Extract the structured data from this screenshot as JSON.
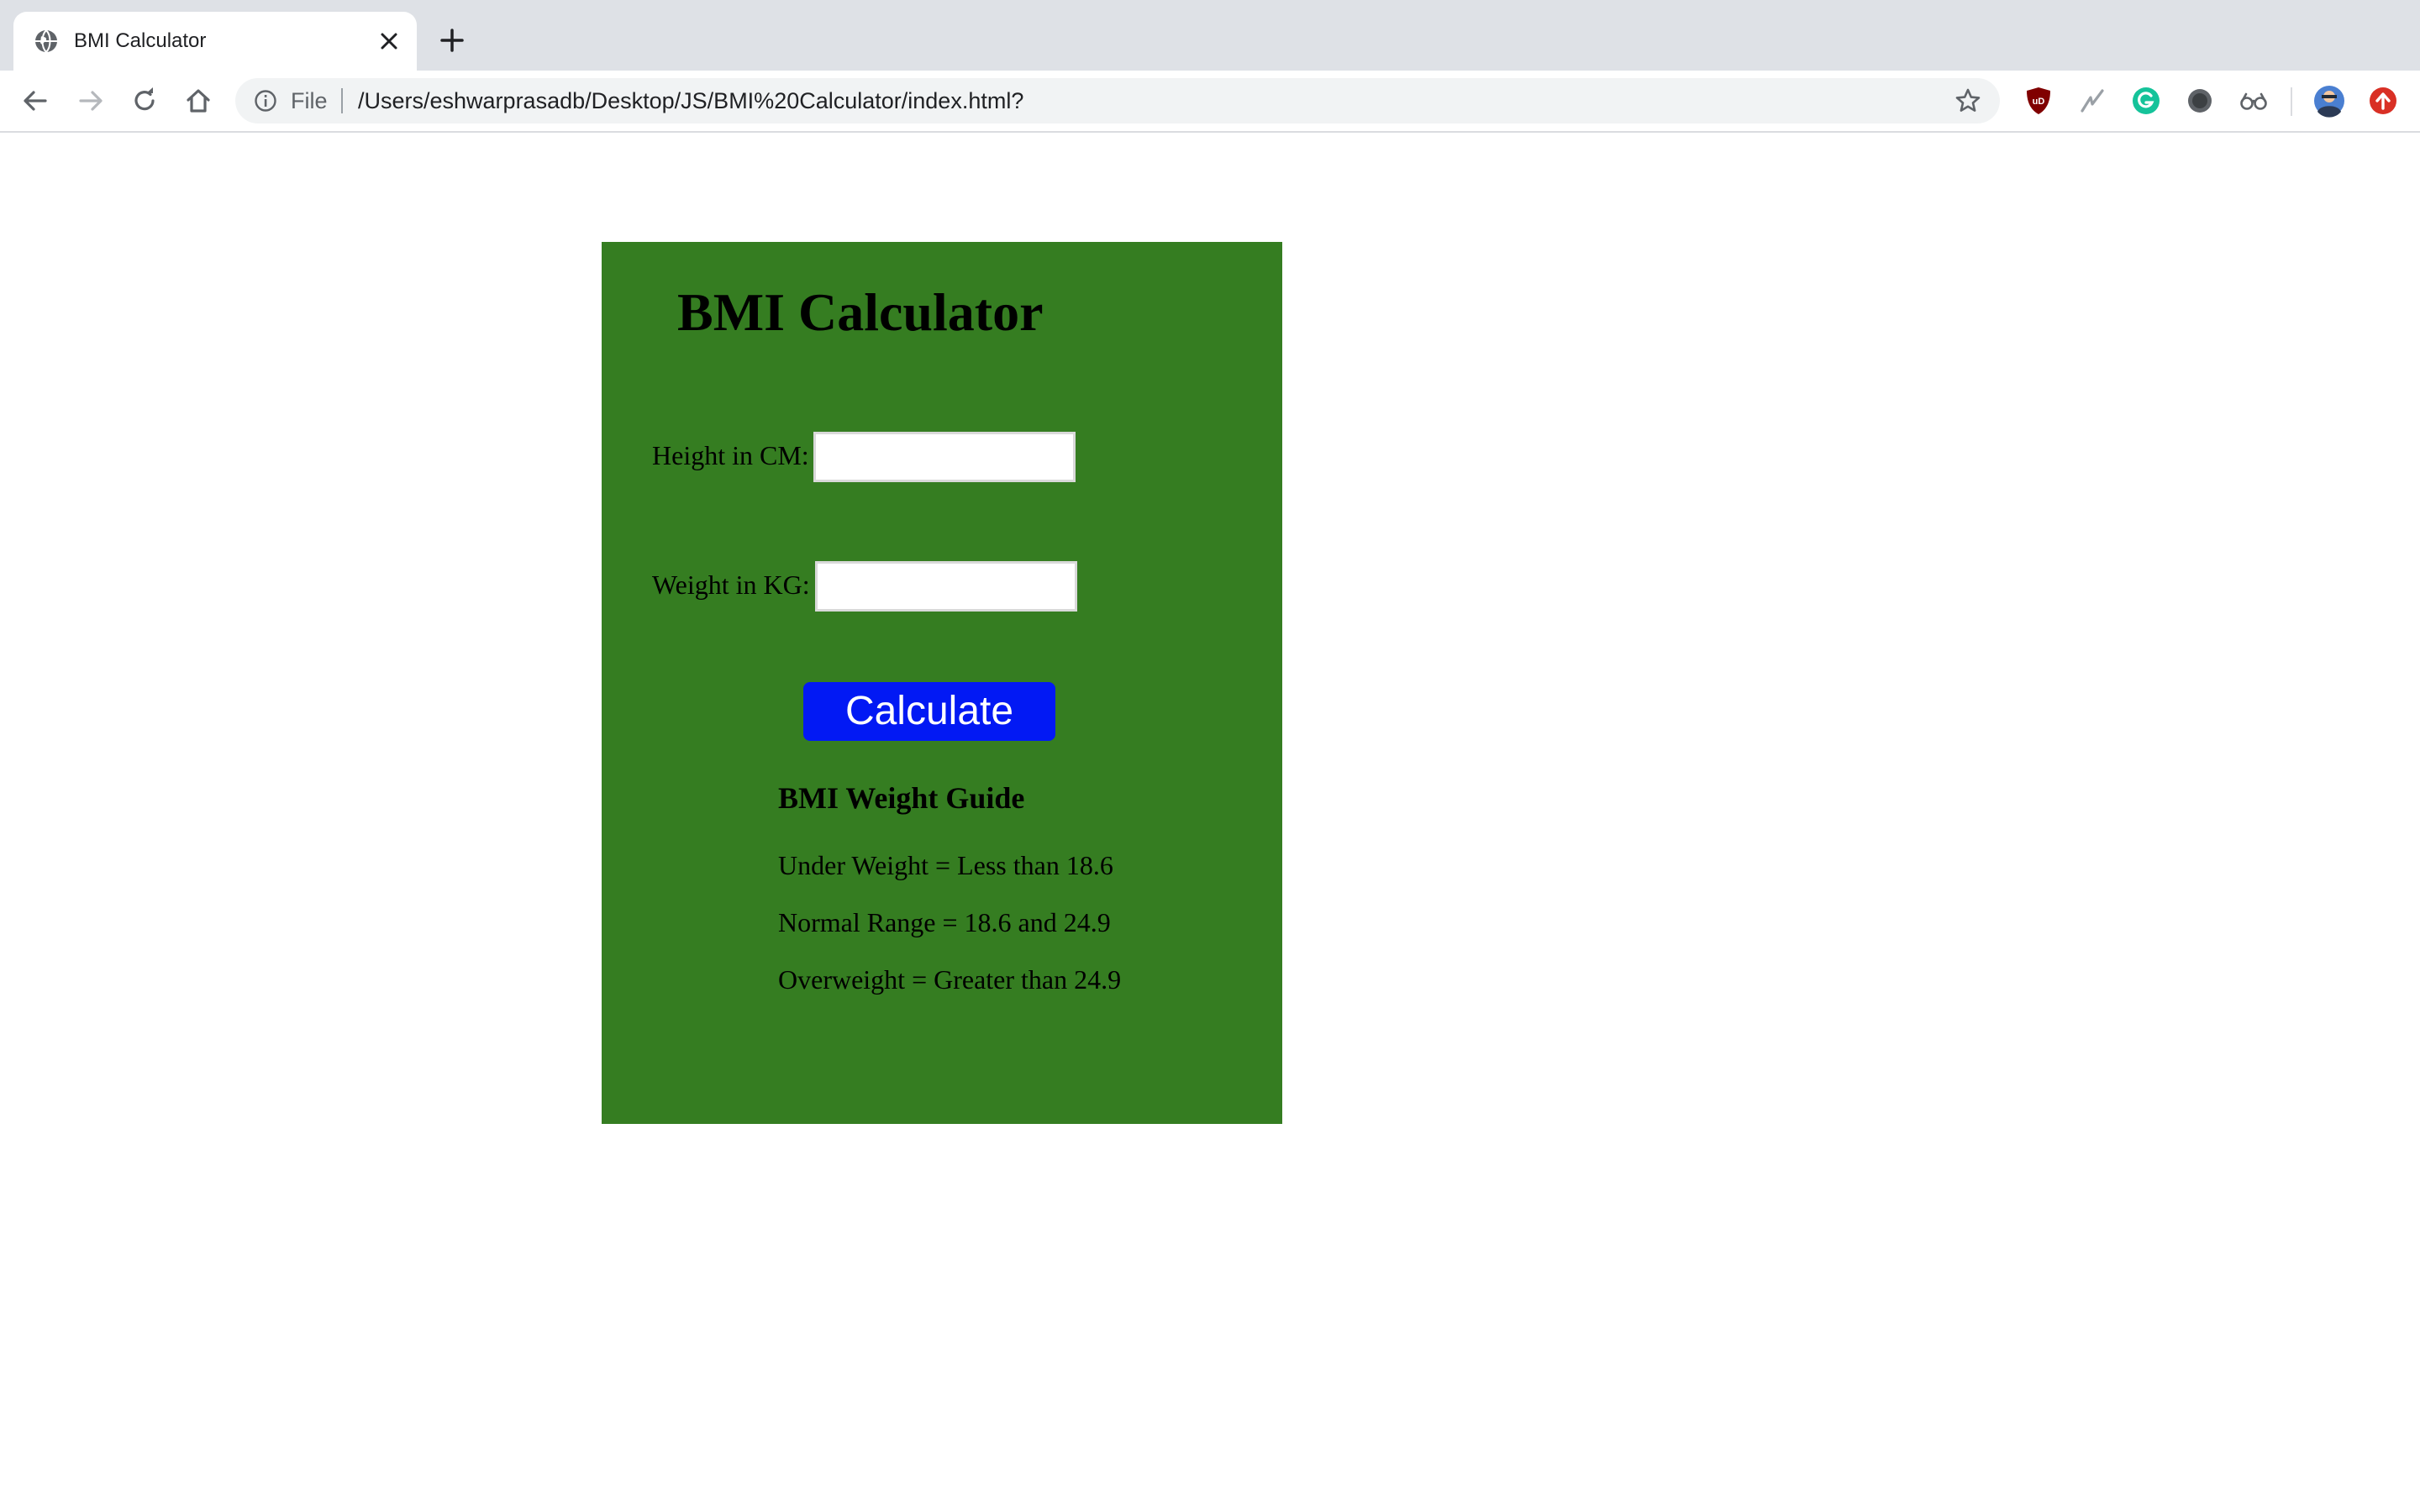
{
  "browser": {
    "tab": {
      "title": "BMI Calculator",
      "favicon": "globe-icon"
    },
    "omnibox": {
      "scheme_label": "File",
      "url": "/Users/eshwarprasadb/Desktop/JS/BMI%20Calculator/index.html?"
    },
    "extensions": [
      "ublock-shield-icon",
      "lightning-icon",
      "grammarly-icon",
      "record-icon",
      "glasses-icon"
    ],
    "colors": {
      "tabstrip": "#dee1e6",
      "omnibox": "#f1f3f4"
    }
  },
  "page": {
    "title": "BMI Calculator",
    "height_label": "Height in CM:",
    "height_value": "",
    "weight_label": "Weight in KG:",
    "weight_value": "",
    "calculate_label": "Calculate",
    "guide": {
      "title": "BMI Weight Guide",
      "items": [
        "Under Weight = Less than 18.6",
        "Normal Range = 18.6 and 24.9",
        "Overweight = Greater than 24.9"
      ]
    },
    "colors": {
      "panel_background": "#357d21",
      "button_background": "#0219f4",
      "button_text": "#ffffff"
    }
  }
}
